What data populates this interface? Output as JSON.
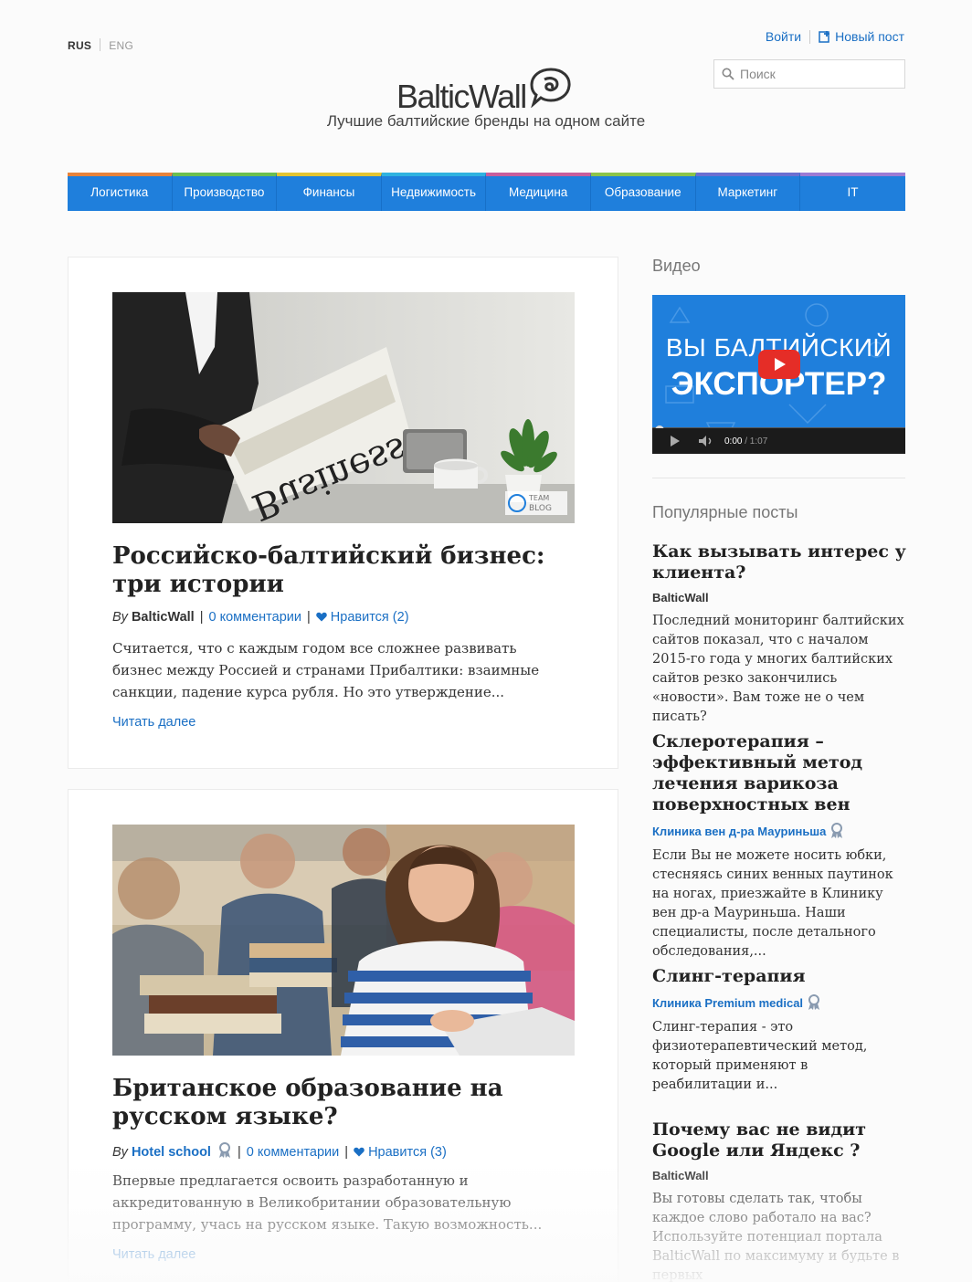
{
  "lang": {
    "active": "RUS",
    "inactive": "ENG"
  },
  "toplinks": {
    "login": "Войти",
    "new_post": "Новый пост"
  },
  "search": {
    "placeholder": "Поиск"
  },
  "logo": {
    "text": "BalticWall",
    "tagline": "Лучшие балтийские бренды на одном сайте"
  },
  "nav": {
    "items": [
      {
        "label": "Логистика",
        "color": "#e8833a"
      },
      {
        "label": "Производство",
        "color": "#6cbf4f"
      },
      {
        "label": "Финансы",
        "color": "#e3c431"
      },
      {
        "label": "Недвижимость",
        "color": "#2fb2e0"
      },
      {
        "label": "Медицина",
        "color": "#c85e9c"
      },
      {
        "label": "Образование",
        "color": "#8cc44a"
      },
      {
        "label": "Маркетинг",
        "color": "#6b6fd1"
      },
      {
        "label": "IT",
        "color": "#9c7bd4"
      }
    ]
  },
  "articles": [
    {
      "image": "newspaper-business",
      "image_badge": "TEAM BLOG",
      "title": "Российско-балтийский бизнес: три истории",
      "by": "By",
      "author": "BalticWall",
      "comments": "0 комментарии",
      "likes": "Нравится (2)",
      "excerpt": "Считается, что с каждым годом все сложнее развивать бизнес между Россией и странами Прибалтики: взаимные санкции, падение курса рубля. Но это утверждение...",
      "more": "Читать далее"
    },
    {
      "image": "students-books",
      "title": "Британское образование на русском языке?",
      "by": "By",
      "author": "Hotel school",
      "comments": "0 комментарии",
      "likes": "Нравится (3)",
      "excerpt": "Впервые предлагается освоить разработанную и аккредитованную в Великобритании образовательную программу, учась на русском языке. Такую возможность...",
      "more": "Читать далее"
    }
  ],
  "sidebar": {
    "video_heading": "Видео",
    "video": {
      "line1": "ВЫ БАЛТИЙСКИЙ",
      "line2": "ЭКСПОРТЕР?",
      "time": "0:00",
      "duration": "/ 1:07"
    },
    "popular_heading": "Популярные посты",
    "popular": [
      {
        "title": "Как вызывать интерес у клиента?",
        "author": "BalticWall",
        "excerpt": "Последний мониторинг балтийских сайтов показал, что с началом 2015-го года у многих балтийских сайтов резко закончились «новости». Вам тоже не о чем писать?"
      },
      {
        "title": "Склеротерапия – эффективный метод лечения варикоза поверхностных вен",
        "author": "Клиника вен д-ра Мауриньша",
        "excerpt": "Если Вы не можете носить юбки, стесняясь синих венных паутинок на ногах, приезжайте в Клинику вен др-а Мауриньша. Наши специалисты, после детального обследования,..."
      },
      {
        "title": "Слинг-терапия",
        "author": "Клиника Premium medical",
        "excerpt": "Слинг-терапия - это физиотерапевтический метод, который применяют в реабилитации и..."
      },
      {
        "title": "Почему вас не видит Google или Яндекс ?",
        "author": "BalticWall",
        "excerpt": "Вы готовы сделать так, чтобы каждое слово работало на вас? Используйте потенциал портала BalticWall по максимуму и будьте в первых"
      }
    ]
  }
}
